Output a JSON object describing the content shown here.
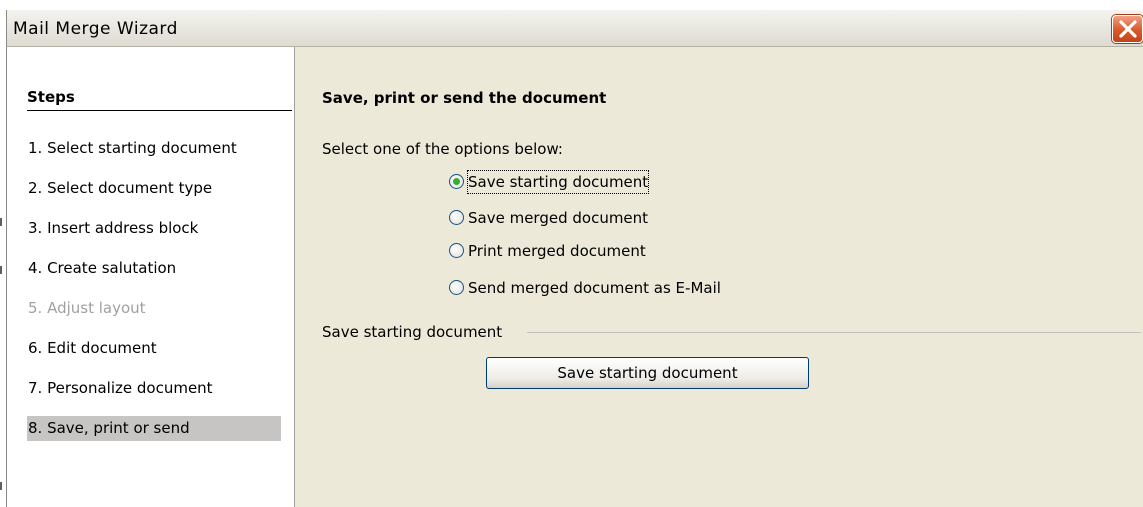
{
  "window": {
    "title": "Mail Merge Wizard"
  },
  "steps": {
    "heading": "Steps",
    "items": [
      {
        "label": "1. Select starting document",
        "state": "enabled"
      },
      {
        "label": "2. Select document type",
        "state": "enabled"
      },
      {
        "label": "3. Insert address block",
        "state": "enabled"
      },
      {
        "label": "4. Create salutation",
        "state": "enabled"
      },
      {
        "label": "5. Adjust layout",
        "state": "disabled"
      },
      {
        "label": "6. Edit document",
        "state": "enabled"
      },
      {
        "label": "7. Personalize document",
        "state": "enabled"
      },
      {
        "label": "8. Save, print or send",
        "state": "current"
      }
    ]
  },
  "main": {
    "title": "Save, print or send the document",
    "instruction": "Select one of the options below:",
    "options": [
      {
        "label": "Save starting document",
        "checked": true
      },
      {
        "label": "Save merged document",
        "checked": false
      },
      {
        "label": "Print merged document",
        "checked": false
      },
      {
        "label": "Send merged document as E-Mail",
        "checked": false
      }
    ],
    "group_label": "Save starting document",
    "action_button": "Save starting document"
  },
  "colors": {
    "dialog_bg": "#ece9d8",
    "selected_step_bg": "#c6c5c3",
    "disabled_text": "#a0a0a0",
    "radio_selected": "#2fb12f",
    "close_button": "#d9582b"
  }
}
